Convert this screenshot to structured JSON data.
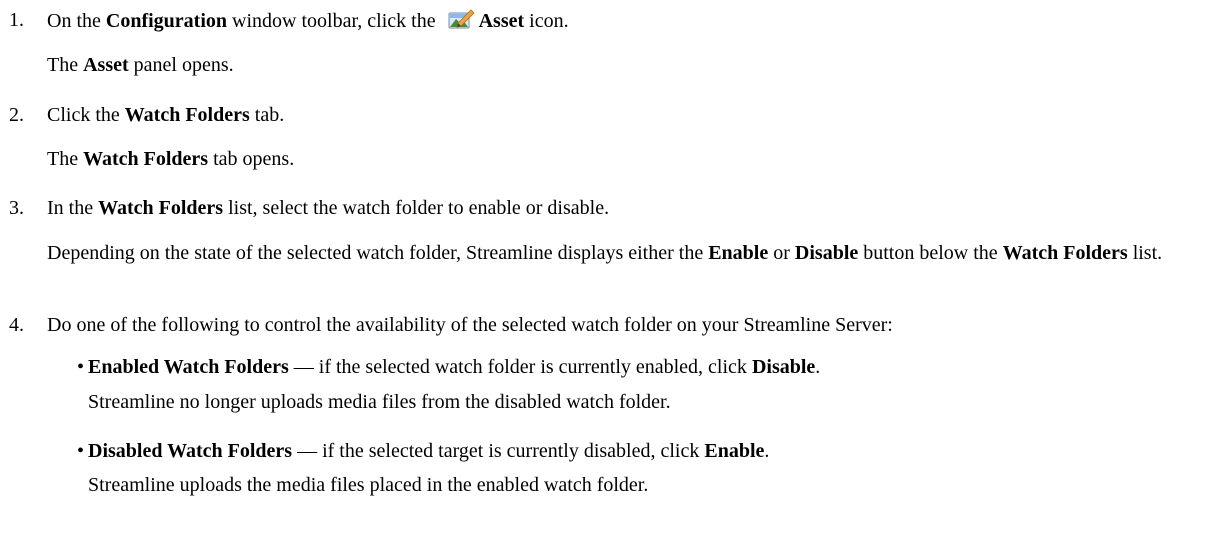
{
  "steps": [
    {
      "number": "1.",
      "text_a": "On the ",
      "bold_a": "Configuration",
      "text_b": " window toolbar, click the ",
      "bold_b": "Asset",
      "text_c": " icon.",
      "icon": "asset-icon",
      "result_a": "The ",
      "result_bold": "Asset",
      "result_b": " panel opens."
    },
    {
      "number": "2.",
      "text_a": "Click the ",
      "bold_a": "Watch Folders",
      "text_b": " tab.",
      "result_a": "The ",
      "result_bold": "Watch Folders",
      "result_b": " tab opens."
    },
    {
      "number": "3.",
      "text_a": "In the ",
      "bold_a": "Watch Folders",
      "text_b": " list, select the watch folder to enable or disable.",
      "result_a": "Depending on the state of the selected watch folder, Streamline displays either the ",
      "result_bold_a": "Enable",
      "result_b": " or ",
      "result_bold_b": "Disable",
      "result_c": " button below the ",
      "result_bold_c": "Watch Folders",
      "result_d": " list."
    },
    {
      "number": "4.",
      "text_a": "Do one of the following to control the availability of the selected watch folder on your Streamline Server:",
      "bullets": [
        {
          "bullet": "•",
          "bold_a": "Enabled Watch Folders",
          "text_a": " — if the selected watch folder is currently enabled, click ",
          "bold_b": "Disable",
          "text_b": ".",
          "result": "Streamline no longer uploads media files from the disabled watch folder."
        },
        {
          "bullet": "•",
          "bold_a": "Disabled Watch Folders",
          "text_a": " — if the selected target is currently disabled, click ",
          "bold_b": "Enable",
          "text_b": ".",
          "result": "Streamline uploads the media files placed in the enabled watch folder."
        }
      ]
    }
  ]
}
